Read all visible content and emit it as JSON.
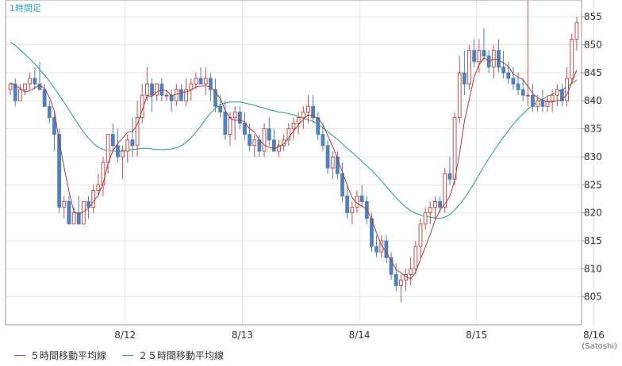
{
  "chart_data": {
    "type": "candlestick",
    "title": "1時間足",
    "credit": "(Satoshi)",
    "y_axis": {
      "position": "right",
      "ylim": [
        800,
        858
      ],
      "ticks": [
        805,
        810,
        815,
        820,
        825,
        830,
        835,
        840,
        845,
        850,
        855
      ]
    },
    "x_axis": {
      "tick_labels": [
        "8/12",
        "8/13",
        "8/14",
        "8/15",
        "8/16"
      ],
      "tick_index": [
        24,
        48,
        72,
        96,
        120
      ]
    },
    "grid": true,
    "colors": {
      "up": "#c0504d",
      "down": "#4f81bd",
      "ma5": "#b03a3a",
      "ma25": "#22a06b",
      "grid": "#e3e3e3",
      "frame": "#999999",
      "title": "#29a3c4"
    },
    "legend": [
      {
        "name": "５時間移動平均線",
        "color": "#b03a3a"
      },
      {
        "name": "２５時間移動平均線",
        "color": "#22a06b"
      }
    ],
    "candles_ohlc": [
      [
        842,
        843,
        841,
        843
      ],
      [
        843,
        844,
        839,
        840
      ],
      [
        840,
        843,
        840,
        842
      ],
      [
        842,
        843,
        841,
        843
      ],
      [
        843,
        845,
        842,
        844
      ],
      [
        844,
        846,
        842,
        843
      ],
      [
        843,
        847,
        842,
        842
      ],
      [
        842,
        843,
        839,
        839
      ],
      [
        839,
        840,
        836,
        837
      ],
      [
        837,
        838,
        831,
        834
      ],
      [
        834,
        835,
        820,
        821
      ],
      [
        821,
        823,
        819,
        822
      ],
      [
        822,
        823,
        818,
        818
      ],
      [
        818,
        821,
        818,
        820
      ],
      [
        820,
        823,
        818,
        818
      ],
      [
        818,
        822,
        818,
        822
      ],
      [
        822,
        823,
        819,
        821
      ],
      [
        821,
        825,
        820,
        824
      ],
      [
        824,
        827,
        823,
        825
      ],
      [
        825,
        830,
        823,
        829
      ],
      [
        829,
        834,
        827,
        834
      ],
      [
        834,
        836,
        831,
        832
      ],
      [
        832,
        835,
        829,
        830
      ],
      [
        830,
        832,
        826,
        831
      ],
      [
        831,
        834,
        829,
        833
      ],
      [
        833,
        837,
        830,
        832
      ],
      [
        832,
        840,
        830,
        837
      ],
      [
        837,
        843,
        836,
        841
      ],
      [
        841,
        846,
        840,
        843
      ],
      [
        843,
        844,
        838,
        841
      ],
      [
        841,
        843,
        840,
        843
      ],
      [
        843,
        844,
        840,
        841
      ],
      [
        841,
        842,
        840,
        841
      ],
      [
        841,
        842,
        838,
        840
      ],
      [
        840,
        843,
        839,
        842
      ],
      [
        842,
        843,
        840,
        840
      ],
      [
        840,
        844,
        839,
        842
      ],
      [
        842,
        844,
        840,
        843
      ],
      [
        843,
        845,
        842,
        844
      ],
      [
        844,
        846,
        843,
        843
      ],
      [
        843,
        846,
        841,
        844
      ],
      [
        844,
        845,
        840,
        842
      ],
      [
        842,
        844,
        838,
        839
      ],
      [
        839,
        841,
        837,
        838
      ],
      [
        838,
        840,
        833,
        834
      ],
      [
        834,
        838,
        832,
        837
      ],
      [
        837,
        839,
        833,
        838
      ],
      [
        838,
        839,
        835,
        836
      ],
      [
        836,
        838,
        833,
        834
      ],
      [
        834,
        836,
        831,
        832
      ],
      [
        832,
        834,
        830,
        833
      ],
      [
        833,
        834,
        830,
        831
      ],
      [
        831,
        836,
        830,
        835
      ],
      [
        835,
        837,
        832,
        833
      ],
      [
        833,
        835,
        831,
        831
      ],
      [
        831,
        833,
        830,
        832
      ],
      [
        832,
        834,
        831,
        833
      ],
      [
        833,
        836,
        832,
        835
      ],
      [
        835,
        837,
        833,
        836
      ],
      [
        836,
        838,
        834,
        837
      ],
      [
        837,
        839,
        835,
        838
      ],
      [
        838,
        841,
        836,
        839
      ],
      [
        839,
        841,
        836,
        837
      ],
      [
        837,
        838,
        833,
        834
      ],
      [
        834,
        836,
        831,
        832
      ],
      [
        832,
        833,
        827,
        828
      ],
      [
        828,
        831,
        826,
        830
      ],
      [
        830,
        831,
        826,
        827
      ],
      [
        827,
        829,
        822,
        823
      ],
      [
        823,
        825,
        819,
        820
      ],
      [
        820,
        822,
        818,
        821
      ],
      [
        821,
        824,
        820,
        823
      ],
      [
        823,
        825,
        821,
        822
      ],
      [
        822,
        823,
        818,
        819
      ],
      [
        819,
        820,
        813,
        814
      ],
      [
        814,
        816,
        812,
        813
      ],
      [
        813,
        816,
        812,
        815
      ],
      [
        815,
        816,
        811,
        812
      ],
      [
        812,
        813,
        808,
        809
      ],
      [
        809,
        811,
        806,
        807
      ],
      [
        807,
        809,
        804,
        808
      ],
      [
        808,
        810,
        806,
        809
      ],
      [
        809,
        812,
        807,
        810
      ],
      [
        810,
        815,
        809,
        814
      ],
      [
        814,
        819,
        812,
        818
      ],
      [
        818,
        821,
        817,
        820
      ],
      [
        820,
        822,
        818,
        821
      ],
      [
        821,
        823,
        819,
        822
      ],
      [
        822,
        823,
        820,
        821
      ],
      [
        821,
        828,
        820,
        827
      ],
      [
        827,
        830,
        825,
        826
      ],
      [
        826,
        838,
        825,
        837
      ],
      [
        837,
        848,
        836,
        845
      ],
      [
        845,
        849,
        841,
        843
      ],
      [
        843,
        850,
        842,
        849
      ],
      [
        849,
        851,
        846,
        847
      ],
      [
        847,
        851,
        845,
        849
      ],
      [
        849,
        853,
        847,
        848
      ],
      [
        848,
        849,
        845,
        846
      ],
      [
        846,
        850,
        844,
        849
      ],
      [
        849,
        851,
        845,
        846
      ],
      [
        846,
        849,
        844,
        845
      ],
      [
        845,
        847,
        843,
        844
      ],
      [
        844,
        846,
        842,
        843
      ],
      [
        843,
        845,
        841,
        842
      ],
      [
        842,
        844,
        840,
        841
      ],
      [
        841,
        858,
        839,
        841
      ],
      [
        841,
        843,
        838,
        839
      ],
      [
        839,
        841,
        838,
        840
      ],
      [
        840,
        842,
        838,
        839
      ],
      [
        839,
        841,
        838,
        840
      ],
      [
        840,
        842,
        838,
        841
      ],
      [
        841,
        843,
        839,
        842
      ],
      [
        842,
        843,
        839,
        840
      ],
      [
        840,
        846,
        839,
        844
      ],
      [
        844,
        852,
        843,
        851
      ],
      [
        851,
        855,
        849,
        854
      ]
    ],
    "ma5": [
      843.2,
      842.8,
      842.2,
      841.6,
      841.8,
      842.3,
      842.8,
      842.2,
      840.6,
      838.2,
      832.8,
      828.1,
      823.8,
      820.2,
      819.8,
      820.2,
      820.8,
      822.0,
      823.1,
      825.3,
      828.8,
      831.1,
      832.4,
      833.3,
      834.4,
      834.5,
      835.8,
      838.3,
      840.9,
      840.8,
      841.6,
      842.0,
      841.8,
      840.9,
      841.2,
      841.4,
      841.6,
      841.9,
      842.5,
      842.6,
      842.7,
      842.4,
      841.6,
      840.4,
      838.3,
      836.9,
      836.5,
      836.6,
      836.2,
      835.0,
      834.4,
      833.0,
      832.1,
      831.7,
      831.5,
      831.8,
      832.3,
      833.4,
      834.6,
      835.7,
      836.7,
      837.5,
      837.3,
      836.9,
      835.8,
      833.8,
      831.9,
      829.7,
      827.3,
      824.9,
      822.7,
      821.7,
      821.2,
      820.6,
      818.9,
      816.4,
      814.2,
      812.9,
      811.5,
      809.9,
      809.3,
      808.6,
      808.2,
      809.4,
      811.7,
      813.9,
      816.2,
      818.7,
      820.5,
      821.6,
      822.9,
      825.8,
      830.5,
      836.4,
      840.2,
      844.3,
      846.4,
      847.7,
      847.1,
      847.4,
      847.3,
      846.8,
      846.1,
      844.8,
      844.2,
      843.8,
      842.6,
      841.3,
      840.5,
      840.1,
      839.8,
      839.8,
      840.0,
      840.2,
      841.1,
      843.3,
      845.5
    ],
    "ma25": [
      850.5,
      849.9,
      849.1,
      848.3,
      847.5,
      846.6,
      845.6,
      844.6,
      843.5,
      842.3,
      841.0,
      839.7,
      838.4,
      837.0,
      835.7,
      834.4,
      833.3,
      832.4,
      831.7,
      831.3,
      831.1,
      831.0,
      831.0,
      831.1,
      831.2,
      831.3,
      831.4,
      831.5,
      831.5,
      831.4,
      831.3,
      831.3,
      831.3,
      831.4,
      831.6,
      832.0,
      832.6,
      833.4,
      834.4,
      835.5,
      836.7,
      837.8,
      838.7,
      839.3,
      839.6,
      839.8,
      839.8,
      839.8,
      839.6,
      839.4,
      839.2,
      838.9,
      838.7,
      838.4,
      838.2,
      838.0,
      837.9,
      837.7,
      837.5,
      837.2,
      836.9,
      836.6,
      836.3,
      835.8,
      835.2,
      834.5,
      833.8,
      833.1,
      832.3,
      831.5,
      830.8,
      830.0,
      829.2,
      828.4,
      827.6,
      826.7,
      825.7,
      824.7,
      823.7,
      822.7,
      821.8,
      821.0,
      820.4,
      819.9,
      819.6,
      819.4,
      819.2,
      819.1,
      819.0,
      819.2,
      819.7,
      820.5,
      821.5,
      822.6,
      823.9,
      825.3,
      826.8,
      828.3,
      829.7,
      831.0,
      832.3,
      833.5,
      834.7,
      835.8,
      836.8,
      837.7,
      838.5,
      839.2,
      839.8,
      840.3,
      840.8,
      841.2,
      841.6,
      842.0,
      842.5,
      843.1,
      843.7
    ]
  }
}
